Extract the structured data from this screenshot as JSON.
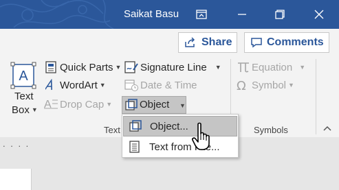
{
  "titlebar": {
    "user_name": "Saikat Basu",
    "icons": [
      "ribbon-display-icon",
      "minimize-icon",
      "restore-icon",
      "close-icon"
    ]
  },
  "actions": {
    "share_label": "Share",
    "comments_label": "Comments"
  },
  "text_group": {
    "label": "Text",
    "text_box_line1": "Text",
    "text_box_line2": "Box",
    "quick_parts": "Quick Parts",
    "wordart": "WordArt",
    "drop_cap": "Drop Cap",
    "signature_line": "Signature Line",
    "date_time": "Date & Time",
    "object": "Object"
  },
  "symbols_group": {
    "label": "Symbols",
    "equation": "Equation",
    "symbol": "Symbol"
  },
  "object_menu": {
    "items": [
      {
        "label": "Object...",
        "icon": "object-icon",
        "highlighted": true
      },
      {
        "label": "Text from File...",
        "icon": "text-file-icon",
        "highlighted": false
      }
    ]
  },
  "ruler": {
    "dots": ". . . ."
  },
  "colors": {
    "titlebar": "#2b579a",
    "accent": "#2b579a",
    "ribbon": "#f3f3f3",
    "highlight": "#c5c5c5"
  }
}
